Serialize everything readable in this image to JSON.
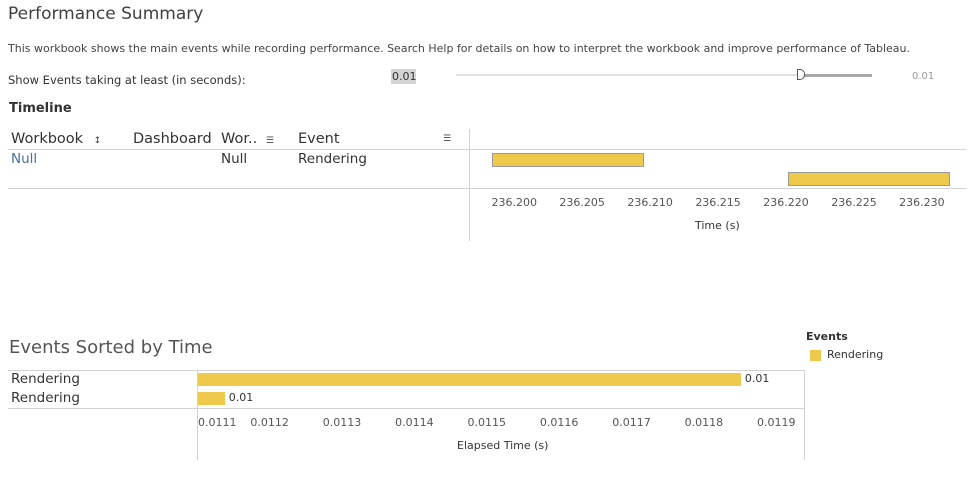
{
  "header": {
    "title": "Performance Summary",
    "description": "This workbook shows the main events while recording performance. Search Help for details on how to interpret the workbook and improve performance of Tableau."
  },
  "filter": {
    "label": "Show Events taking at least (in seconds):",
    "value": "0.01",
    "slider_max_label": "0.01",
    "slider_level": 0.83
  },
  "timeline": {
    "section_label": "Timeline",
    "columns": [
      "Workbook",
      "Dashboard",
      "Wor..",
      "Event"
    ],
    "row": {
      "workbook": "Null",
      "dashboard": "",
      "worksheet": "Null",
      "event": "Rendering"
    }
  },
  "events_section": {
    "title": "Events Sorted by Time"
  },
  "legend": {
    "title": "Events",
    "items": [
      {
        "label": "Rendering",
        "color": "#efc94c"
      }
    ]
  },
  "chart_data": [
    {
      "type": "bar",
      "orientation": "horizontal-gantt",
      "xlabel": "Time (s)",
      "xlim": [
        236.1968,
        236.2333
      ],
      "x_ticks": [
        "236.200",
        "236.205",
        "236.210",
        "236.215",
        "236.220",
        "236.225",
        "236.230"
      ],
      "tick_values": [
        236.2,
        236.205,
        236.21,
        236.215,
        236.22,
        236.225,
        236.23
      ],
      "bars": [
        {
          "category": "Rendering",
          "start": 236.1984,
          "end": 236.2096,
          "lane": 0
        },
        {
          "category": "Rendering",
          "start": 236.2202,
          "end": 236.2321,
          "lane": 1
        }
      ]
    },
    {
      "type": "bar",
      "orientation": "horizontal",
      "xlabel": "Elapsed Time (s)",
      "xlim": [
        0.0111,
        0.01194
      ],
      "x_ticks": [
        "0.0111",
        "0.0112",
        "0.0113",
        "0.0114",
        "0.0115",
        "0.0116",
        "0.0117",
        "0.0118",
        "0.0119"
      ],
      "tick_values": [
        0.0111,
        0.0112,
        0.0113,
        0.0114,
        0.0115,
        0.0116,
        0.0117,
        0.0118,
        0.0119
      ],
      "categories": [
        "Rendering",
        "Rendering"
      ],
      "values": [
        0.01185,
        0.011137
      ],
      "data_labels": [
        "0.01",
        "0.01"
      ]
    }
  ]
}
